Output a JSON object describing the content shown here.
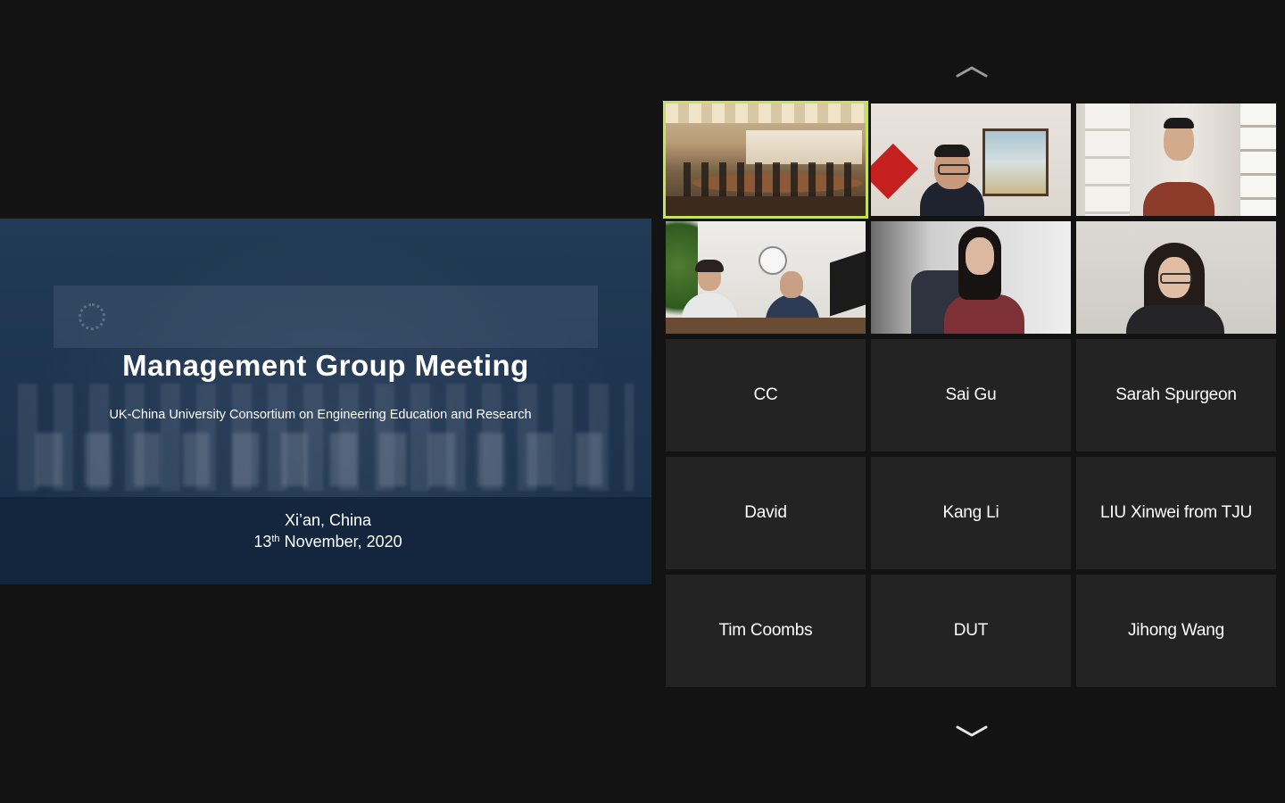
{
  "slide": {
    "title": "Management Group Meeting",
    "subtitle": "UK-China University Consortium on Engineering Education and Research",
    "location": "Xi’an, China",
    "date_day": "13",
    "date_suffix": "th",
    "date_rest": " November, 2020"
  },
  "gallery": {
    "scroll_up_icon": "chevron-up-icon",
    "scroll_down_icon": "chevron-down-icon",
    "active_speaker_color": "#c4e25a",
    "video_tiles": [
      {
        "scene": "conference-room",
        "active_speaker": true
      },
      {
        "scene": "office-man-glasses"
      },
      {
        "scene": "office-man-young"
      },
      {
        "scene": "office-two-people"
      },
      {
        "scene": "home-woman"
      },
      {
        "scene": "home-woman-glasses"
      }
    ],
    "name_tiles": [
      "CC",
      "Sai Gu",
      "Sarah Spurgeon",
      "David",
      "Kang Li",
      "LIU Xinwei from TJU",
      "Tim Coombs",
      "DUT",
      "Jihong Wang"
    ]
  }
}
